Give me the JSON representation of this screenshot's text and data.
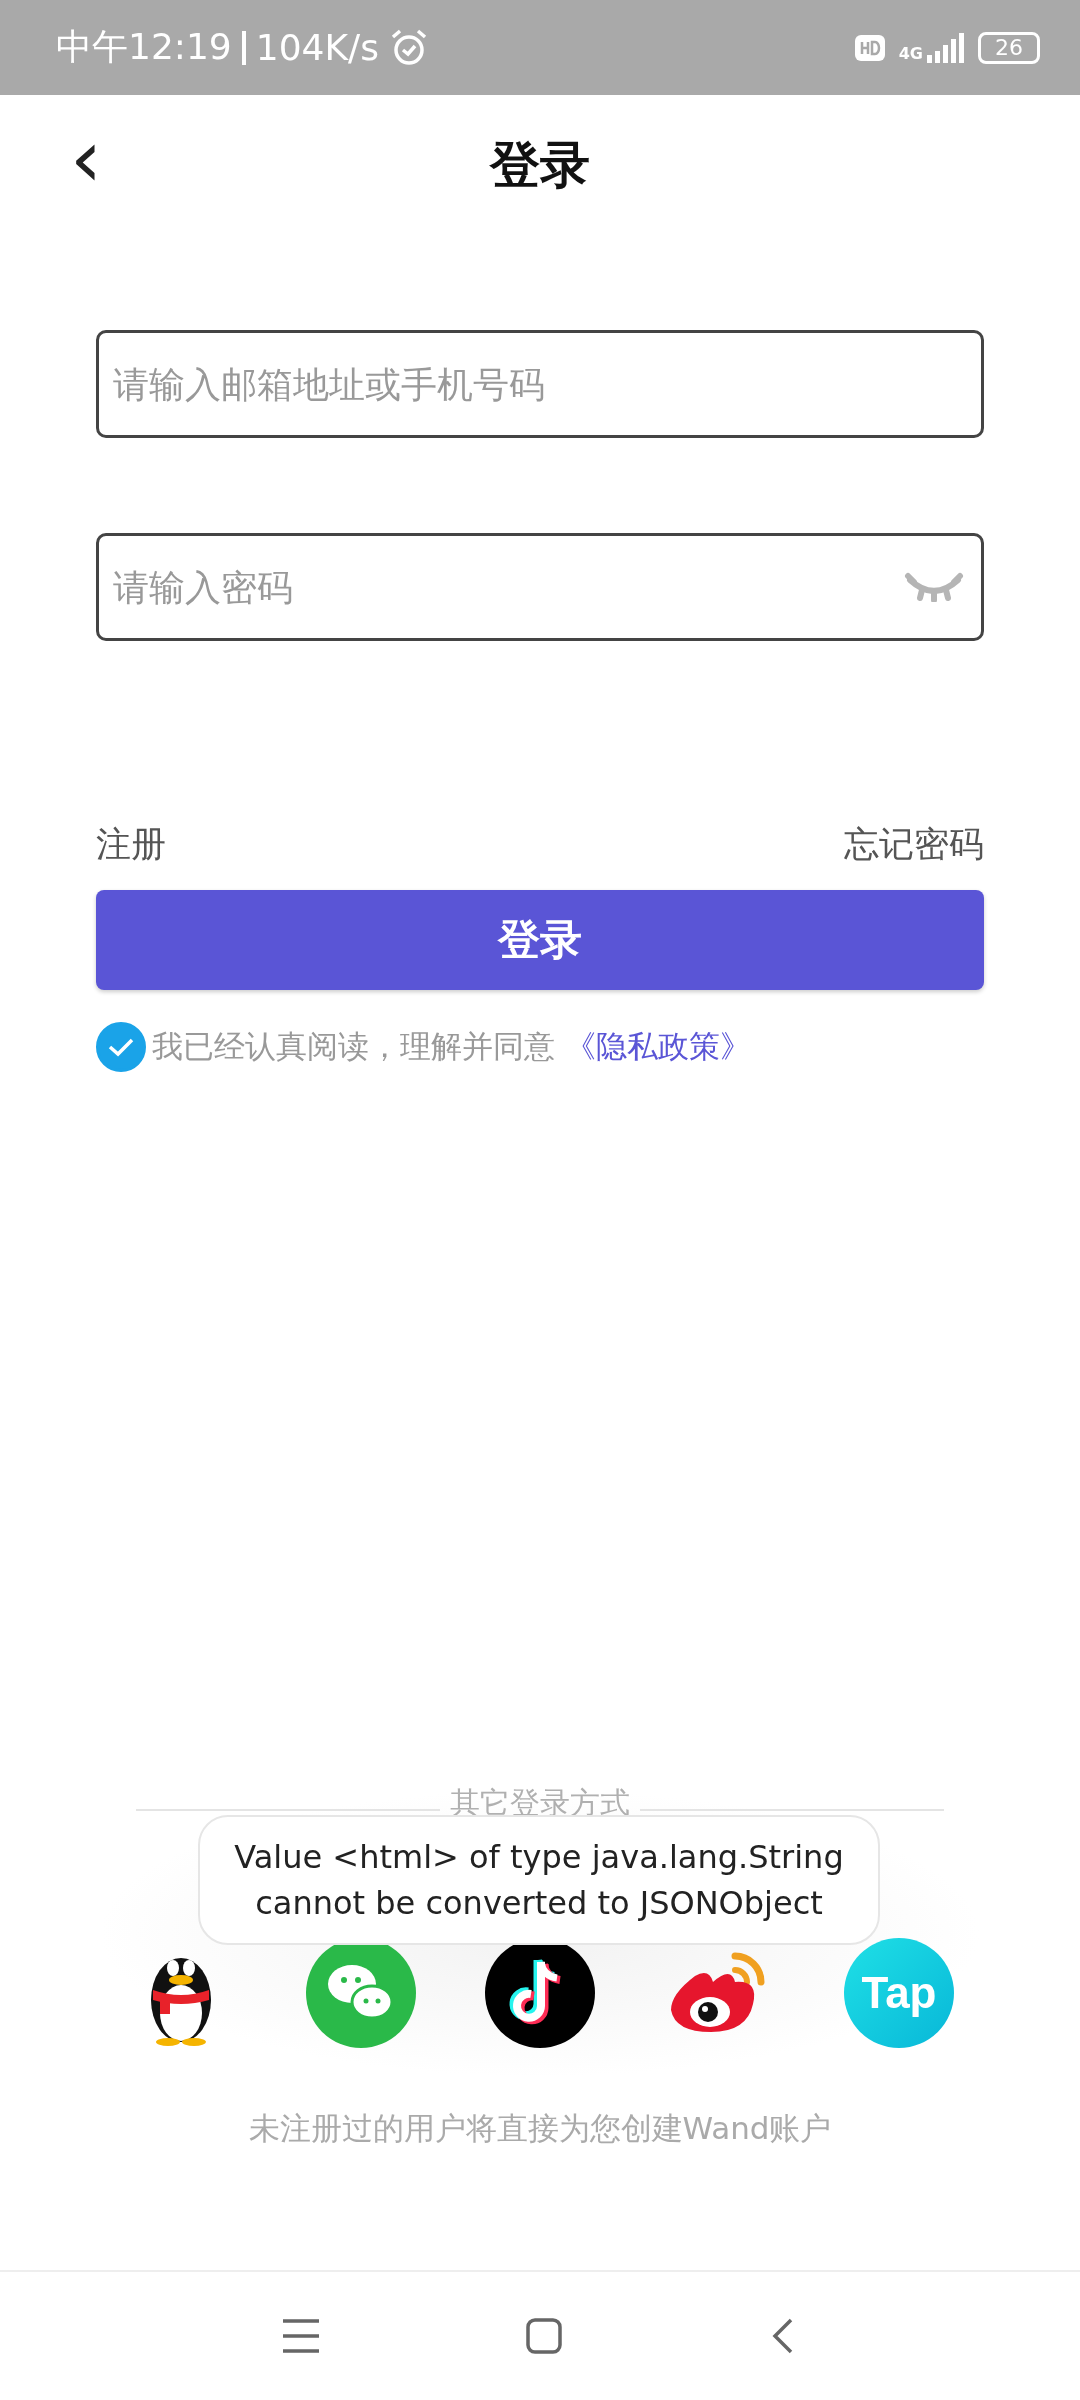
{
  "status_bar": {
    "time": "中午12:19",
    "speed": "104K/s",
    "network": "4G",
    "battery": "26"
  },
  "header": {
    "back": "‹",
    "title": "登录"
  },
  "fields": [
    {
      "kind": "account",
      "placeholder": "请输入邮箱地址或手机号码"
    },
    {
      "kind": "password",
      "placeholder": "请输入密码"
    }
  ],
  "links": {
    "register": "注册",
    "forgot": "忘记密码"
  },
  "login_button": "登录",
  "agreement": {
    "checked": true,
    "text": "我已经认真阅读，理解并同意",
    "link": "《隐私政策》"
  },
  "other_login": {
    "title": "其它登录方式",
    "providers": [
      {
        "kind": "penguin"
      },
      {
        "kind": "chat"
      },
      {
        "kind": "note"
      },
      {
        "kind": "weibo"
      },
      {
        "kind": "tap",
        "label": "Tap"
      }
    ]
  },
  "note": "未注册过的用户将直接为您创建Wand账户",
  "toast": [
    "Value <html> of type java.lang.String",
    "cannot be converted to JSONObject"
  ]
}
